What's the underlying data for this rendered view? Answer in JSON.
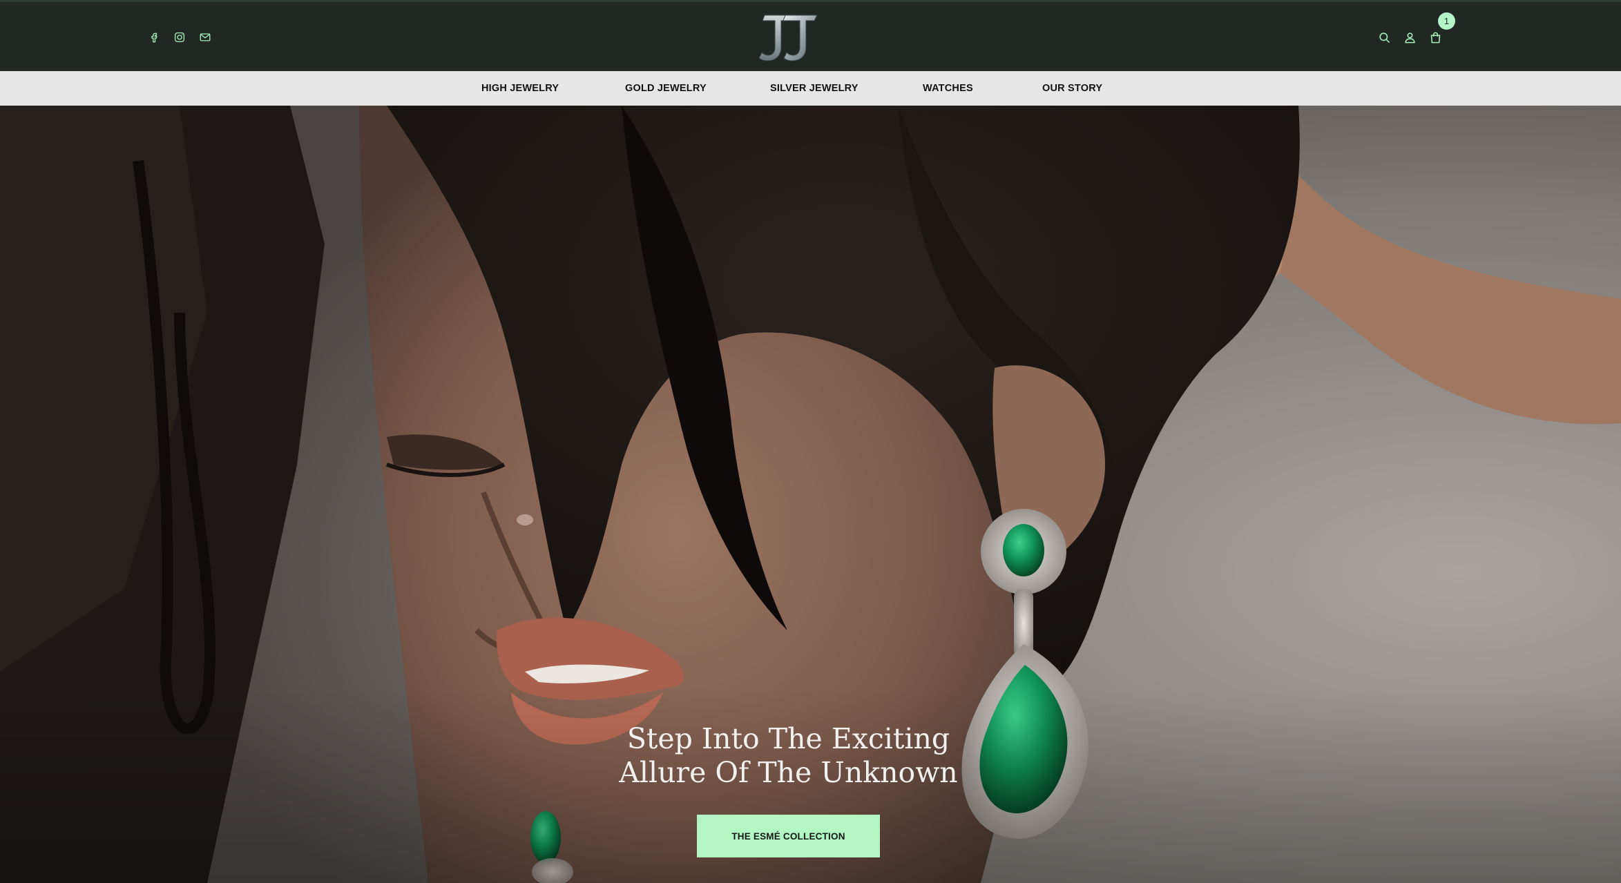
{
  "header": {
    "social_icons": [
      "facebook-icon",
      "instagram-icon",
      "mail-icon"
    ],
    "logo_icon": "jj-monogram-logo",
    "action_icons": [
      "search-icon",
      "account-icon",
      "cart-icon"
    ],
    "cart_count": "1",
    "colors": {
      "topbar_bg": "#212824",
      "badge_bg": "#b2f5c6",
      "icon_color": "#a6f0b8"
    }
  },
  "nav": {
    "items": [
      {
        "label": "HIGH JEWELRY"
      },
      {
        "label": "GOLD JEWELRY"
      },
      {
        "label": "SILVER JEWELRY"
      },
      {
        "label": "WATCHES"
      },
      {
        "label": "OUR STORY"
      }
    ],
    "colors": {
      "bg": "#e6e6e6",
      "text": "#111111"
    }
  },
  "hero": {
    "title_line1": "Step Into The Exciting",
    "title_line2": "Allure Of The Unknown",
    "cta_label": "THE ESMÉ COLLECTION",
    "colors": {
      "cta_bg": "#b3f5c3",
      "title": "#f3f1ee"
    }
  }
}
